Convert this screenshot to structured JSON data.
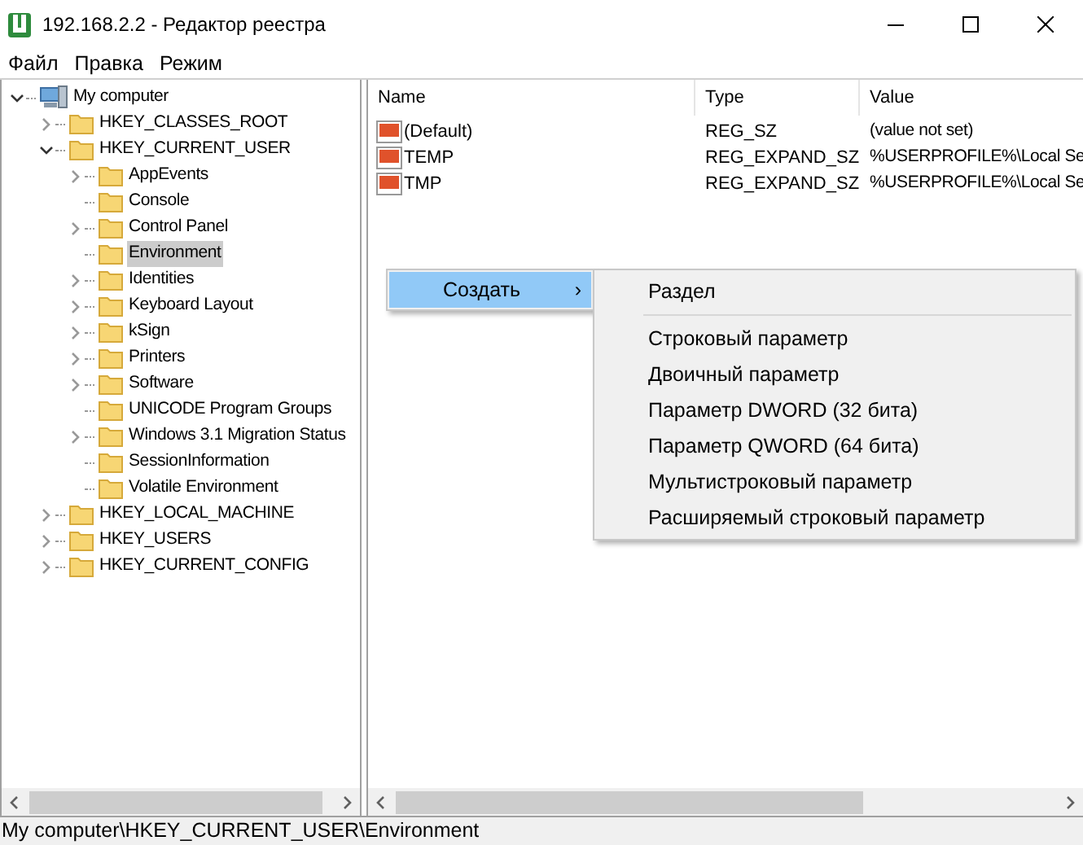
{
  "window": {
    "title": "192.168.2.2 - Редактор реестра"
  },
  "menu": [
    "Файл",
    "Правка",
    "Режим"
  ],
  "tree": [
    {
      "label": "My computer",
      "kind": "computer",
      "expanded": true,
      "selected": false,
      "children": [
        {
          "label": "HKEY_CLASSES_ROOT",
          "kind": "branch",
          "expanded": false,
          "selected": false
        },
        {
          "label": "HKEY_CURRENT_USER",
          "kind": "branch",
          "expanded": true,
          "selected": false,
          "children": [
            {
              "label": "AppEvents",
              "kind": "branch",
              "expanded": false,
              "selected": false
            },
            {
              "label": "Console",
              "kind": "leaf",
              "selected": false
            },
            {
              "label": "Control Panel",
              "kind": "branch",
              "expanded": false,
              "selected": false
            },
            {
              "label": "Environment",
              "kind": "leaf",
              "selected": true
            },
            {
              "label": "Identities",
              "kind": "branch",
              "expanded": false,
              "selected": false
            },
            {
              "label": "Keyboard Layout",
              "kind": "branch",
              "expanded": false,
              "selected": false
            },
            {
              "label": "kSign",
              "kind": "branch",
              "expanded": false,
              "selected": false
            },
            {
              "label": "Printers",
              "kind": "branch",
              "expanded": false,
              "selected": false
            },
            {
              "label": "Software",
              "kind": "branch",
              "expanded": false,
              "selected": false
            },
            {
              "label": "UNICODE Program Groups",
              "kind": "leaf",
              "selected": false
            },
            {
              "label": "Windows 3.1 Migration Status",
              "kind": "branch",
              "expanded": false,
              "selected": false
            },
            {
              "label": "SessionInformation",
              "kind": "leaf",
              "selected": false
            },
            {
              "label": "Volatile Environment",
              "kind": "leaf",
              "selected": false
            }
          ]
        },
        {
          "label": "HKEY_LOCAL_MACHINE",
          "kind": "branch",
          "expanded": false,
          "selected": false
        },
        {
          "label": "HKEY_USERS",
          "kind": "branch",
          "expanded": false,
          "selected": false
        },
        {
          "label": "HKEY_CURRENT_CONFIG",
          "kind": "branch",
          "expanded": false,
          "selected": false
        }
      ]
    }
  ],
  "table": {
    "columns": [
      "Name",
      "Type",
      "Value"
    ],
    "rows": [
      {
        "name": "(Default)",
        "type": "REG_SZ",
        "value": "(value not set)"
      },
      {
        "name": "TEMP",
        "type": "REG_EXPAND_SZ",
        "value": "%USERPROFILE%\\Local Se"
      },
      {
        "name": "TMP",
        "type": "REG_EXPAND_SZ",
        "value": "%USERPROFILE%\\Local Se"
      }
    ]
  },
  "context_menu": {
    "item": {
      "label": "Создать",
      "arrow": "›"
    },
    "submenu": [
      {
        "label": "Раздел",
        "kind": "item"
      },
      {
        "kind": "separator"
      },
      {
        "label": "Строковый параметр",
        "kind": "item"
      },
      {
        "label": "Двоичный параметр",
        "kind": "item"
      },
      {
        "label": "Параметр DWORD (32 бита)",
        "kind": "item"
      },
      {
        "label": "Параметр QWORD (64 бита)",
        "kind": "item"
      },
      {
        "label": "Мультистроковый параметр",
        "kind": "item"
      },
      {
        "label": "Расширяемый строковый параметр",
        "kind": "item"
      }
    ]
  },
  "status_bar": "My computer\\HKEY_CURRENT_USER\\Environment"
}
